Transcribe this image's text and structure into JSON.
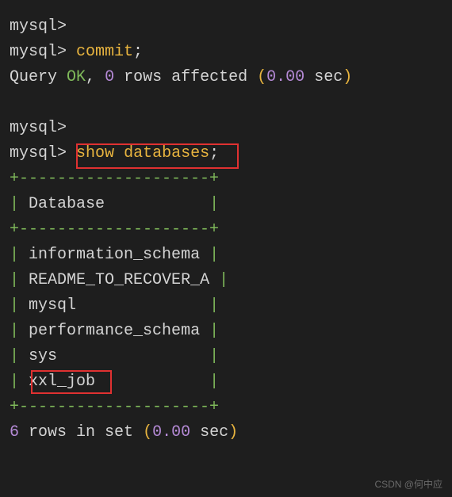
{
  "prompt": "mysql>",
  "commit_cmd": "commit",
  "semicolon": ";",
  "query_result": {
    "status": "Query",
    "ok": "OK",
    "comma": ",",
    "rows": "0",
    "rows_label": "rows affected",
    "time": "0.00",
    "sec": "sec"
  },
  "show_cmd": {
    "show": "show",
    "databases": "databases"
  },
  "table": {
    "border": "+--------------------+",
    "header": "Database",
    "rows": {
      "r0": "information_schema",
      "r1": "README_TO_RECOVER_A",
      "r2": "mysql",
      "r3": "performance_schema",
      "r4": "sys",
      "r5": "xxl_job"
    }
  },
  "footer": {
    "count": "6",
    "label": "rows in set",
    "time": "0.00",
    "sec": "sec"
  },
  "watermark": "CSDN @何中应"
}
